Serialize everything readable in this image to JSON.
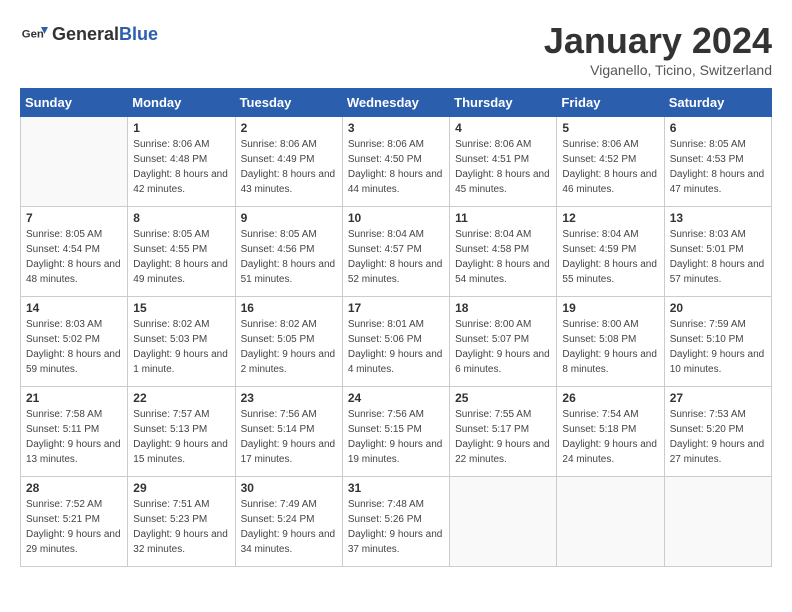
{
  "header": {
    "logo": {
      "text_general": "General",
      "text_blue": "Blue"
    },
    "title": "January 2024",
    "subtitle": "Viganello, Ticino, Switzerland"
  },
  "weekdays": [
    "Sunday",
    "Monday",
    "Tuesday",
    "Wednesday",
    "Thursday",
    "Friday",
    "Saturday"
  ],
  "weeks": [
    [
      {
        "day": "",
        "sunrise": "",
        "sunset": "",
        "daylight": "",
        "empty": true
      },
      {
        "day": "1",
        "sunrise": "Sunrise: 8:06 AM",
        "sunset": "Sunset: 4:48 PM",
        "daylight": "Daylight: 8 hours and 42 minutes."
      },
      {
        "day": "2",
        "sunrise": "Sunrise: 8:06 AM",
        "sunset": "Sunset: 4:49 PM",
        "daylight": "Daylight: 8 hours and 43 minutes."
      },
      {
        "day": "3",
        "sunrise": "Sunrise: 8:06 AM",
        "sunset": "Sunset: 4:50 PM",
        "daylight": "Daylight: 8 hours and 44 minutes."
      },
      {
        "day": "4",
        "sunrise": "Sunrise: 8:06 AM",
        "sunset": "Sunset: 4:51 PM",
        "daylight": "Daylight: 8 hours and 45 minutes."
      },
      {
        "day": "5",
        "sunrise": "Sunrise: 8:06 AM",
        "sunset": "Sunset: 4:52 PM",
        "daylight": "Daylight: 8 hours and 46 minutes."
      },
      {
        "day": "6",
        "sunrise": "Sunrise: 8:05 AM",
        "sunset": "Sunset: 4:53 PM",
        "daylight": "Daylight: 8 hours and 47 minutes."
      }
    ],
    [
      {
        "day": "7",
        "sunrise": "Sunrise: 8:05 AM",
        "sunset": "Sunset: 4:54 PM",
        "daylight": "Daylight: 8 hours and 48 minutes."
      },
      {
        "day": "8",
        "sunrise": "Sunrise: 8:05 AM",
        "sunset": "Sunset: 4:55 PM",
        "daylight": "Daylight: 8 hours and 49 minutes."
      },
      {
        "day": "9",
        "sunrise": "Sunrise: 8:05 AM",
        "sunset": "Sunset: 4:56 PM",
        "daylight": "Daylight: 8 hours and 51 minutes."
      },
      {
        "day": "10",
        "sunrise": "Sunrise: 8:04 AM",
        "sunset": "Sunset: 4:57 PM",
        "daylight": "Daylight: 8 hours and 52 minutes."
      },
      {
        "day": "11",
        "sunrise": "Sunrise: 8:04 AM",
        "sunset": "Sunset: 4:58 PM",
        "daylight": "Daylight: 8 hours and 54 minutes."
      },
      {
        "day": "12",
        "sunrise": "Sunrise: 8:04 AM",
        "sunset": "Sunset: 4:59 PM",
        "daylight": "Daylight: 8 hours and 55 minutes."
      },
      {
        "day": "13",
        "sunrise": "Sunrise: 8:03 AM",
        "sunset": "Sunset: 5:01 PM",
        "daylight": "Daylight: 8 hours and 57 minutes."
      }
    ],
    [
      {
        "day": "14",
        "sunrise": "Sunrise: 8:03 AM",
        "sunset": "Sunset: 5:02 PM",
        "daylight": "Daylight: 8 hours and 59 minutes."
      },
      {
        "day": "15",
        "sunrise": "Sunrise: 8:02 AM",
        "sunset": "Sunset: 5:03 PM",
        "daylight": "Daylight: 9 hours and 1 minute."
      },
      {
        "day": "16",
        "sunrise": "Sunrise: 8:02 AM",
        "sunset": "Sunset: 5:05 PM",
        "daylight": "Daylight: 9 hours and 2 minutes."
      },
      {
        "day": "17",
        "sunrise": "Sunrise: 8:01 AM",
        "sunset": "Sunset: 5:06 PM",
        "daylight": "Daylight: 9 hours and 4 minutes."
      },
      {
        "day": "18",
        "sunrise": "Sunrise: 8:00 AM",
        "sunset": "Sunset: 5:07 PM",
        "daylight": "Daylight: 9 hours and 6 minutes."
      },
      {
        "day": "19",
        "sunrise": "Sunrise: 8:00 AM",
        "sunset": "Sunset: 5:08 PM",
        "daylight": "Daylight: 9 hours and 8 minutes."
      },
      {
        "day": "20",
        "sunrise": "Sunrise: 7:59 AM",
        "sunset": "Sunset: 5:10 PM",
        "daylight": "Daylight: 9 hours and 10 minutes."
      }
    ],
    [
      {
        "day": "21",
        "sunrise": "Sunrise: 7:58 AM",
        "sunset": "Sunset: 5:11 PM",
        "daylight": "Daylight: 9 hours and 13 minutes."
      },
      {
        "day": "22",
        "sunrise": "Sunrise: 7:57 AM",
        "sunset": "Sunset: 5:13 PM",
        "daylight": "Daylight: 9 hours and 15 minutes."
      },
      {
        "day": "23",
        "sunrise": "Sunrise: 7:56 AM",
        "sunset": "Sunset: 5:14 PM",
        "daylight": "Daylight: 9 hours and 17 minutes."
      },
      {
        "day": "24",
        "sunrise": "Sunrise: 7:56 AM",
        "sunset": "Sunset: 5:15 PM",
        "daylight": "Daylight: 9 hours and 19 minutes."
      },
      {
        "day": "25",
        "sunrise": "Sunrise: 7:55 AM",
        "sunset": "Sunset: 5:17 PM",
        "daylight": "Daylight: 9 hours and 22 minutes."
      },
      {
        "day": "26",
        "sunrise": "Sunrise: 7:54 AM",
        "sunset": "Sunset: 5:18 PM",
        "daylight": "Daylight: 9 hours and 24 minutes."
      },
      {
        "day": "27",
        "sunrise": "Sunrise: 7:53 AM",
        "sunset": "Sunset: 5:20 PM",
        "daylight": "Daylight: 9 hours and 27 minutes."
      }
    ],
    [
      {
        "day": "28",
        "sunrise": "Sunrise: 7:52 AM",
        "sunset": "Sunset: 5:21 PM",
        "daylight": "Daylight: 9 hours and 29 minutes."
      },
      {
        "day": "29",
        "sunrise": "Sunrise: 7:51 AM",
        "sunset": "Sunset: 5:23 PM",
        "daylight": "Daylight: 9 hours and 32 minutes."
      },
      {
        "day": "30",
        "sunrise": "Sunrise: 7:49 AM",
        "sunset": "Sunset: 5:24 PM",
        "daylight": "Daylight: 9 hours and 34 minutes."
      },
      {
        "day": "31",
        "sunrise": "Sunrise: 7:48 AM",
        "sunset": "Sunset: 5:26 PM",
        "daylight": "Daylight: 9 hours and 37 minutes."
      },
      {
        "day": "",
        "sunrise": "",
        "sunset": "",
        "daylight": "",
        "empty": true
      },
      {
        "day": "",
        "sunrise": "",
        "sunset": "",
        "daylight": "",
        "empty": true
      },
      {
        "day": "",
        "sunrise": "",
        "sunset": "",
        "daylight": "",
        "empty": true
      }
    ]
  ]
}
